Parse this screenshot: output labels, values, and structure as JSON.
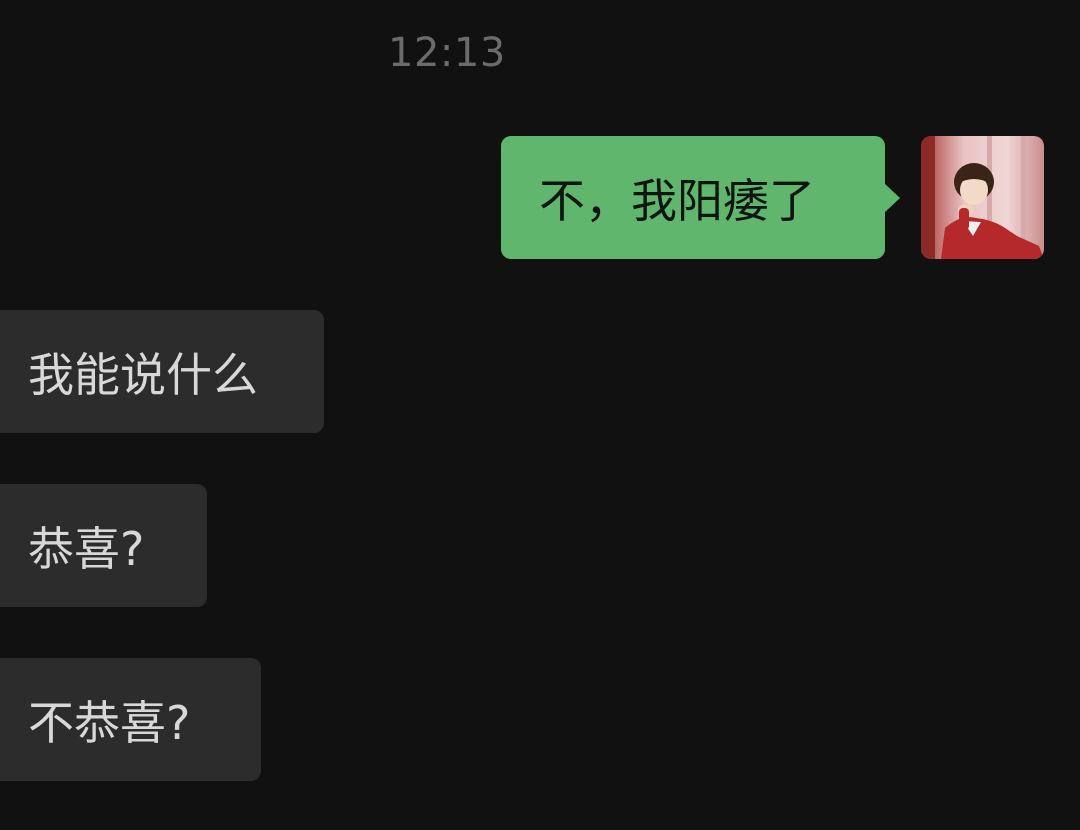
{
  "chat": {
    "timestamp": "12:13",
    "outgoing": [
      {
        "text": "不，我阳痿了"
      }
    ],
    "incoming": [
      {
        "text": "我能说什么"
      },
      {
        "text": "恭喜?"
      },
      {
        "text": "不恭喜?"
      }
    ]
  },
  "colors": {
    "background": "#111111",
    "outgoing_bubble": "#5fb66c",
    "incoming_bubble": "#2c2c2c",
    "timestamp": "#6b6b6b"
  },
  "avatar": {
    "icon": "user-avatar-photo"
  }
}
